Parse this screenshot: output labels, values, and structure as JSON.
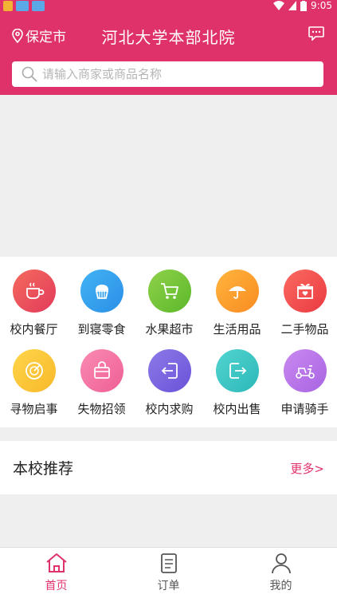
{
  "status_bar": {
    "time": "9:05"
  },
  "header": {
    "location": "保定市",
    "title": "河北大学本部北院",
    "message_icon": "chat-bubble-icon"
  },
  "search": {
    "placeholder": "请输入商家或商品名称"
  },
  "categories": [
    {
      "label": "校内餐厅",
      "icon": "coffee-cup-icon",
      "color_from": "#f46b5e",
      "color_to": "#e23a5a"
    },
    {
      "label": "到寝零食",
      "icon": "cupcake-icon",
      "color_from": "#43b3f5",
      "color_to": "#2a8fe6"
    },
    {
      "label": "水果超市",
      "icon": "shopping-cart-icon",
      "color_from": "#8fd14a",
      "color_to": "#5cb82a"
    },
    {
      "label": "生活用品",
      "icon": "umbrella-icon",
      "color_from": "#ffb43e",
      "color_to": "#f98c22"
    },
    {
      "label": "二手物品",
      "icon": "gift-box-icon",
      "color_from": "#fb6a60",
      "color_to": "#ea3a42"
    },
    {
      "label": "寻物启事",
      "icon": "radar-icon",
      "color_from": "#ffd54a",
      "color_to": "#f8b82a"
    },
    {
      "label": "失物招领",
      "icon": "bag-icon",
      "color_from": "#f98bb3",
      "color_to": "#ef5f95"
    },
    {
      "label": "校内求购",
      "icon": "arrow-in-icon",
      "color_from": "#8d7ae8",
      "color_to": "#6a52d8"
    },
    {
      "label": "校内出售",
      "icon": "arrow-out-icon",
      "color_from": "#52d4d0",
      "color_to": "#2cb8b8"
    },
    {
      "label": "申请骑手",
      "icon": "scooter-icon",
      "color_from": "#c98af0",
      "color_to": "#a863e2"
    }
  ],
  "recommend": {
    "title": "本校推荐",
    "more": "更多>"
  },
  "tabbar": [
    {
      "label": "首页",
      "icon": "home-icon",
      "active": true
    },
    {
      "label": "订单",
      "icon": "order-list-icon",
      "active": false
    },
    {
      "label": "我的",
      "icon": "user-icon",
      "active": false
    }
  ],
  "colors": {
    "accent": "#e0326a"
  }
}
